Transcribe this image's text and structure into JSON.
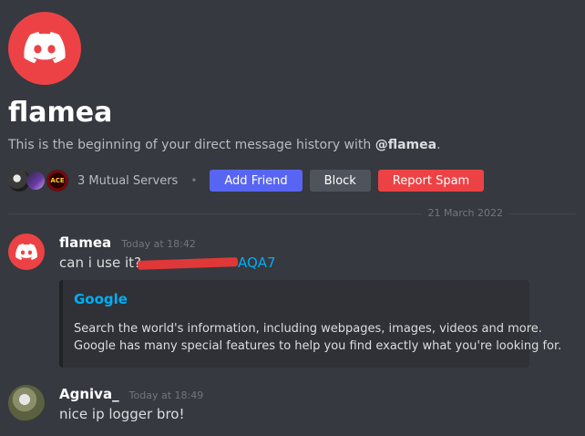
{
  "header": {
    "name": "flamea",
    "intro_prefix": "This is the beginning of your direct message history with ",
    "intro_user": "@flamea",
    "intro_suffix": ".",
    "mutual_servers_text": "3 Mutual Servers",
    "server3_label": "ACE",
    "add_friend_label": "Add Friend",
    "block_label": "Block",
    "report_spam_label": "Report Spam"
  },
  "divider": {
    "date": "21 March 2022"
  },
  "messages": [
    {
      "author": "flamea",
      "timestamp": "Today at 18:42",
      "text": "can i use it?",
      "link_suffix": "AQA7",
      "embed": {
        "title": "Google",
        "desc_line1": "Search the world's information, including webpages, images, videos and more.",
        "desc_line2": "Google has many special features to help you find exactly what you're looking for."
      }
    },
    {
      "author": "Agniva_",
      "timestamp": "Today at 18:49",
      "text": "nice ip logger bro!"
    }
  ],
  "colors": {
    "background": "#36393f",
    "blurple": "#5865f2",
    "danger": "#ed4245",
    "link": "#00aff4"
  },
  "icons": [
    "discord-logo-icon",
    "server-icon"
  ]
}
